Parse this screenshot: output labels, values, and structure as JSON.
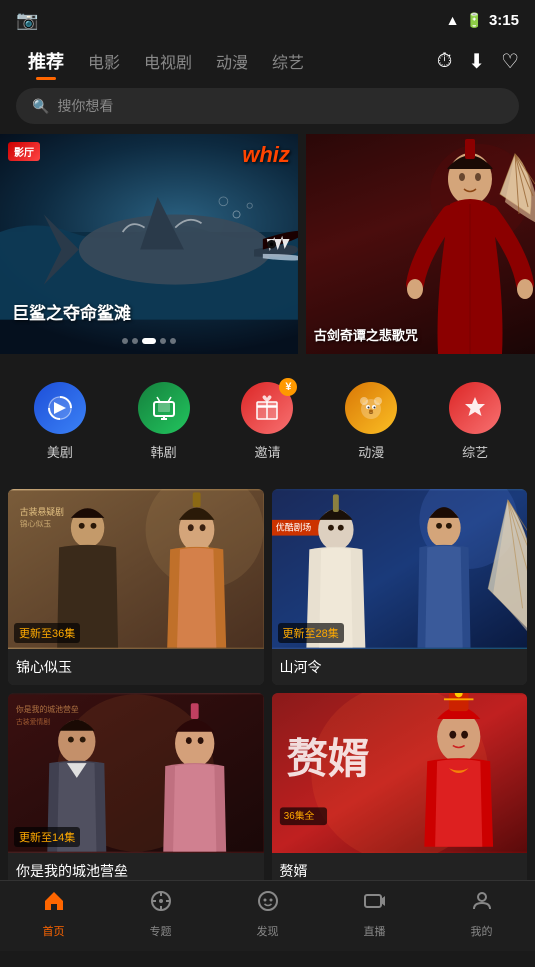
{
  "statusBar": {
    "time": "3:15",
    "batteryIcon": "battery",
    "wifiIcon": "wifi",
    "signalIcon": "signal"
  },
  "nav": {
    "items": [
      {
        "id": "tuijian",
        "label": "推荐",
        "active": true
      },
      {
        "id": "dianying",
        "label": "电影",
        "active": false
      },
      {
        "id": "dianshiju",
        "label": "电视剧",
        "active": false
      },
      {
        "id": "dongman",
        "label": "动漫",
        "active": false
      },
      {
        "id": "zongyi",
        "label": "综艺",
        "active": false
      }
    ],
    "searchPlaceholder": "搜你想看",
    "historyIcon": "history",
    "downloadIcon": "download",
    "favoriteIcon": "favorite"
  },
  "mainBanner": {
    "title": "巨鲨之夺命鲨滩",
    "badge": "影厅",
    "dots": [
      false,
      false,
      true,
      false,
      false
    ]
  },
  "sideBanner": {
    "title": "古剑奇谭之悲歌咒"
  },
  "categories": [
    {
      "id": "meiju",
      "label": "美剧",
      "color": "#2563eb",
      "icon": "🎬"
    },
    {
      "id": "hanju",
      "label": "韩剧",
      "color": "#16a34a",
      "icon": "📺"
    },
    {
      "id": "yaoqing",
      "label": "邀请",
      "color": "#dc2626",
      "icon": "🎁"
    },
    {
      "id": "dongman2",
      "label": "动漫",
      "color": "#d97706",
      "icon": "🐻"
    },
    {
      "id": "zongyi2",
      "label": "综艺",
      "color": "#dc2626",
      "icon": "⭐"
    }
  ],
  "cards": [
    {
      "id": "card1",
      "title": "锦心似玉",
      "badge": "更新至36集",
      "bgClass": "card-bj1",
      "overlayText": "古装悬疑剧\n锦心似玉"
    },
    {
      "id": "card2",
      "title": "山河令",
      "badge": "更新至28集",
      "bgClass": "card-bj2",
      "overlayText": "优酷剧场\n山河令"
    },
    {
      "id": "card3",
      "title": "你是我的城池营垒",
      "badge": "更新至14集",
      "bgClass": "card-bj3",
      "overlayText": ""
    },
    {
      "id": "card4",
      "title": "赘婿",
      "badge": "36集全",
      "bgClass": "card-bj4",
      "overlayText": ""
    }
  ],
  "bottomNav": [
    {
      "id": "home",
      "label": "首页",
      "active": true,
      "icon": "🏠"
    },
    {
      "id": "zhuanti",
      "label": "专题",
      "active": false,
      "icon": "🧭"
    },
    {
      "id": "faxian",
      "label": "发现",
      "active": false,
      "icon": "😊"
    },
    {
      "id": "zhibo",
      "label": "直播",
      "active": false,
      "icon": "📹"
    },
    {
      "id": "wode",
      "label": "我的",
      "active": false,
      "icon": "👤"
    }
  ]
}
